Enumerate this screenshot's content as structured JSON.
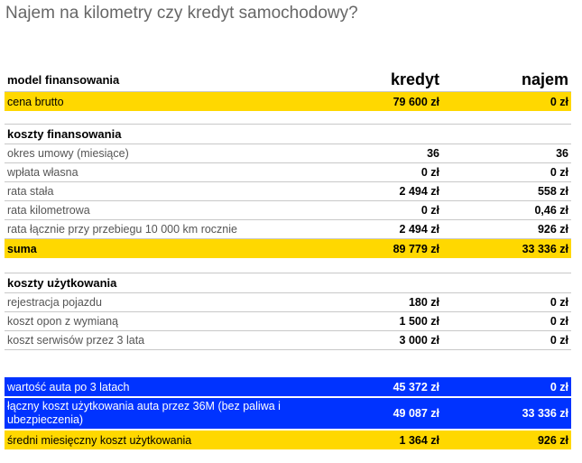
{
  "title": "Najem na kilometry czy kredyt samochodowy?",
  "header": {
    "label": "model finansowania",
    "col1": "kredyt",
    "col2": "najem"
  },
  "price": {
    "label": "cena brutto",
    "col1": "79 600 zł",
    "col2": "0 zł"
  },
  "financing": {
    "title": "koszty finansowania",
    "rows": [
      {
        "label": "okres umowy (miesiące)",
        "col1": "36",
        "col2": "36"
      },
      {
        "label": "wpłata własna",
        "col1": "0 zł",
        "col2": "0 zł"
      },
      {
        "label": "rata stała",
        "col1": "2 494 zł",
        "col2": "558 zł"
      },
      {
        "label": "rata kilometrowa",
        "col1": "0 zł",
        "col2": "0,46 zł"
      },
      {
        "label": "rata łącznie przy przebiegu 10 000 km rocznie",
        "col1": "2 494 zł",
        "col2": "926 zł"
      }
    ],
    "sum": {
      "label": "suma",
      "col1": "89 779 zł",
      "col2": "33 336 zł"
    }
  },
  "usage": {
    "title": "koszty użytkowania",
    "rows": [
      {
        "label": "rejestracja pojazdu",
        "col1": "180 zł",
        "col2": "0 zł"
      },
      {
        "label": "koszt opon z wymianą",
        "col1": "1 500 zł",
        "col2": "0 zł"
      },
      {
        "label": "koszt serwisów przez 3 lata",
        "col1": "3 000 zł",
        "col2": "0 zł"
      }
    ]
  },
  "summary": {
    "value_after": {
      "label": "wartość auta po 3 latach",
      "col1": "45 372 zł",
      "col2": "0 zł"
    },
    "total": {
      "label": "łączny koszt użytkowania auta  przez 36M (bez paliwa i ubezpieczenia)",
      "col1": "49 087 zł",
      "col2": "33 336 zł"
    },
    "monthly": {
      "label": "średni miesięczny koszt użytkowania",
      "col1": "1 364 zł",
      "col2": "926 zł"
    }
  },
  "colors": {
    "yellow": "#ffd800",
    "blue": "#0033ff"
  }
}
